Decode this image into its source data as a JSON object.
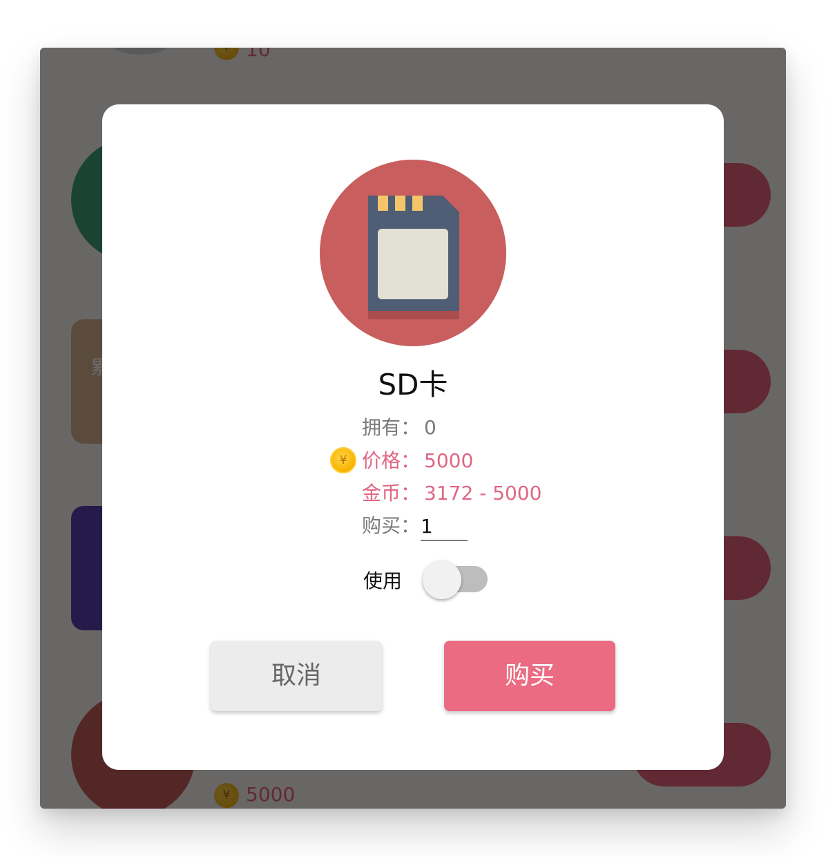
{
  "background_list": {
    "top_price": "10",
    "bottom_price": "5000",
    "partial_text": "累"
  },
  "dialog": {
    "item_name": "SD卡",
    "owned_label": "拥有：",
    "owned_value": "0",
    "price_label": "价格：",
    "price_value": "5000",
    "coins_label": "金币：",
    "coins_value": "3172 - 5000",
    "buy_qty_label": "购买：",
    "buy_qty_value": "1",
    "use_label": "使用",
    "use_toggle_on": false,
    "cancel_button": "取消",
    "buy_button": "购买",
    "coin_symbol": "¥"
  },
  "colors": {
    "accent_pink": "#ea6b82",
    "price_text": "#e06683",
    "sd_card_circle": "#c95e5e",
    "sd_card_body": "#4f5d75"
  }
}
